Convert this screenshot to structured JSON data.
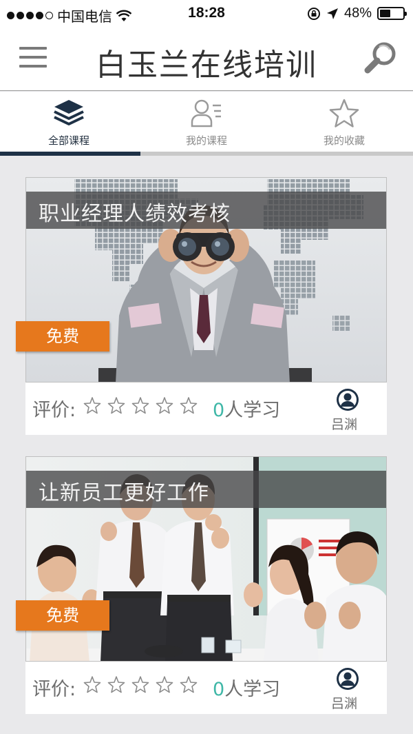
{
  "status_bar": {
    "carrier": "中国电信",
    "time": "18:28",
    "battery": "48%",
    "battery_level": 0.48
  },
  "header": {
    "title": "白玉兰在线培训",
    "menu_icon": "hamburger-menu-icon",
    "search_icon": "search-icon"
  },
  "tabs": [
    {
      "label": "全部课程",
      "icon": "stack-layers-icon",
      "active": true
    },
    {
      "label": "我的课程",
      "icon": "user-list-icon",
      "active": false
    },
    {
      "label": "我的收藏",
      "icon": "star-outline-icon",
      "active": false
    }
  ],
  "courses": [
    {
      "title": "职业经理人绩效考核",
      "badge": "免费",
      "rating_label": "评价:",
      "rating": 0,
      "learners_count": "0",
      "learners_suffix": "人学习",
      "author": "吕渊",
      "image": "businessman-with-binoculars-world-map"
    },
    {
      "title": "让新员工更好工作",
      "badge": "免费",
      "rating_label": "评价:",
      "rating": 0,
      "learners_count": "0",
      "learners_suffix": "人学习",
      "author": "吕渊",
      "image": "office-team-celebrating-meeting"
    }
  ],
  "colors": {
    "badge": "#e6781d",
    "active_tab": "#1e3146",
    "learners_count": "#3fb7a7",
    "avatar": "#1e3146"
  }
}
